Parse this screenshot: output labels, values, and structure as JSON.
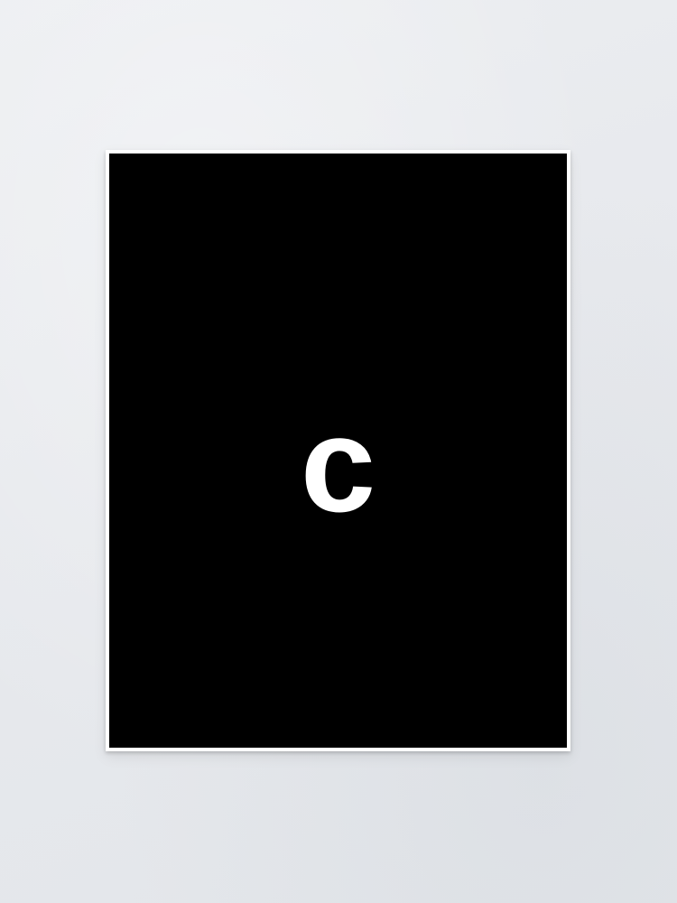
{
  "poster": {
    "letter": "c",
    "background_color": "#000000",
    "letter_color": "#ffffff",
    "border_color": "#ffffff"
  },
  "wall": {
    "color": "#e7e9ed"
  }
}
